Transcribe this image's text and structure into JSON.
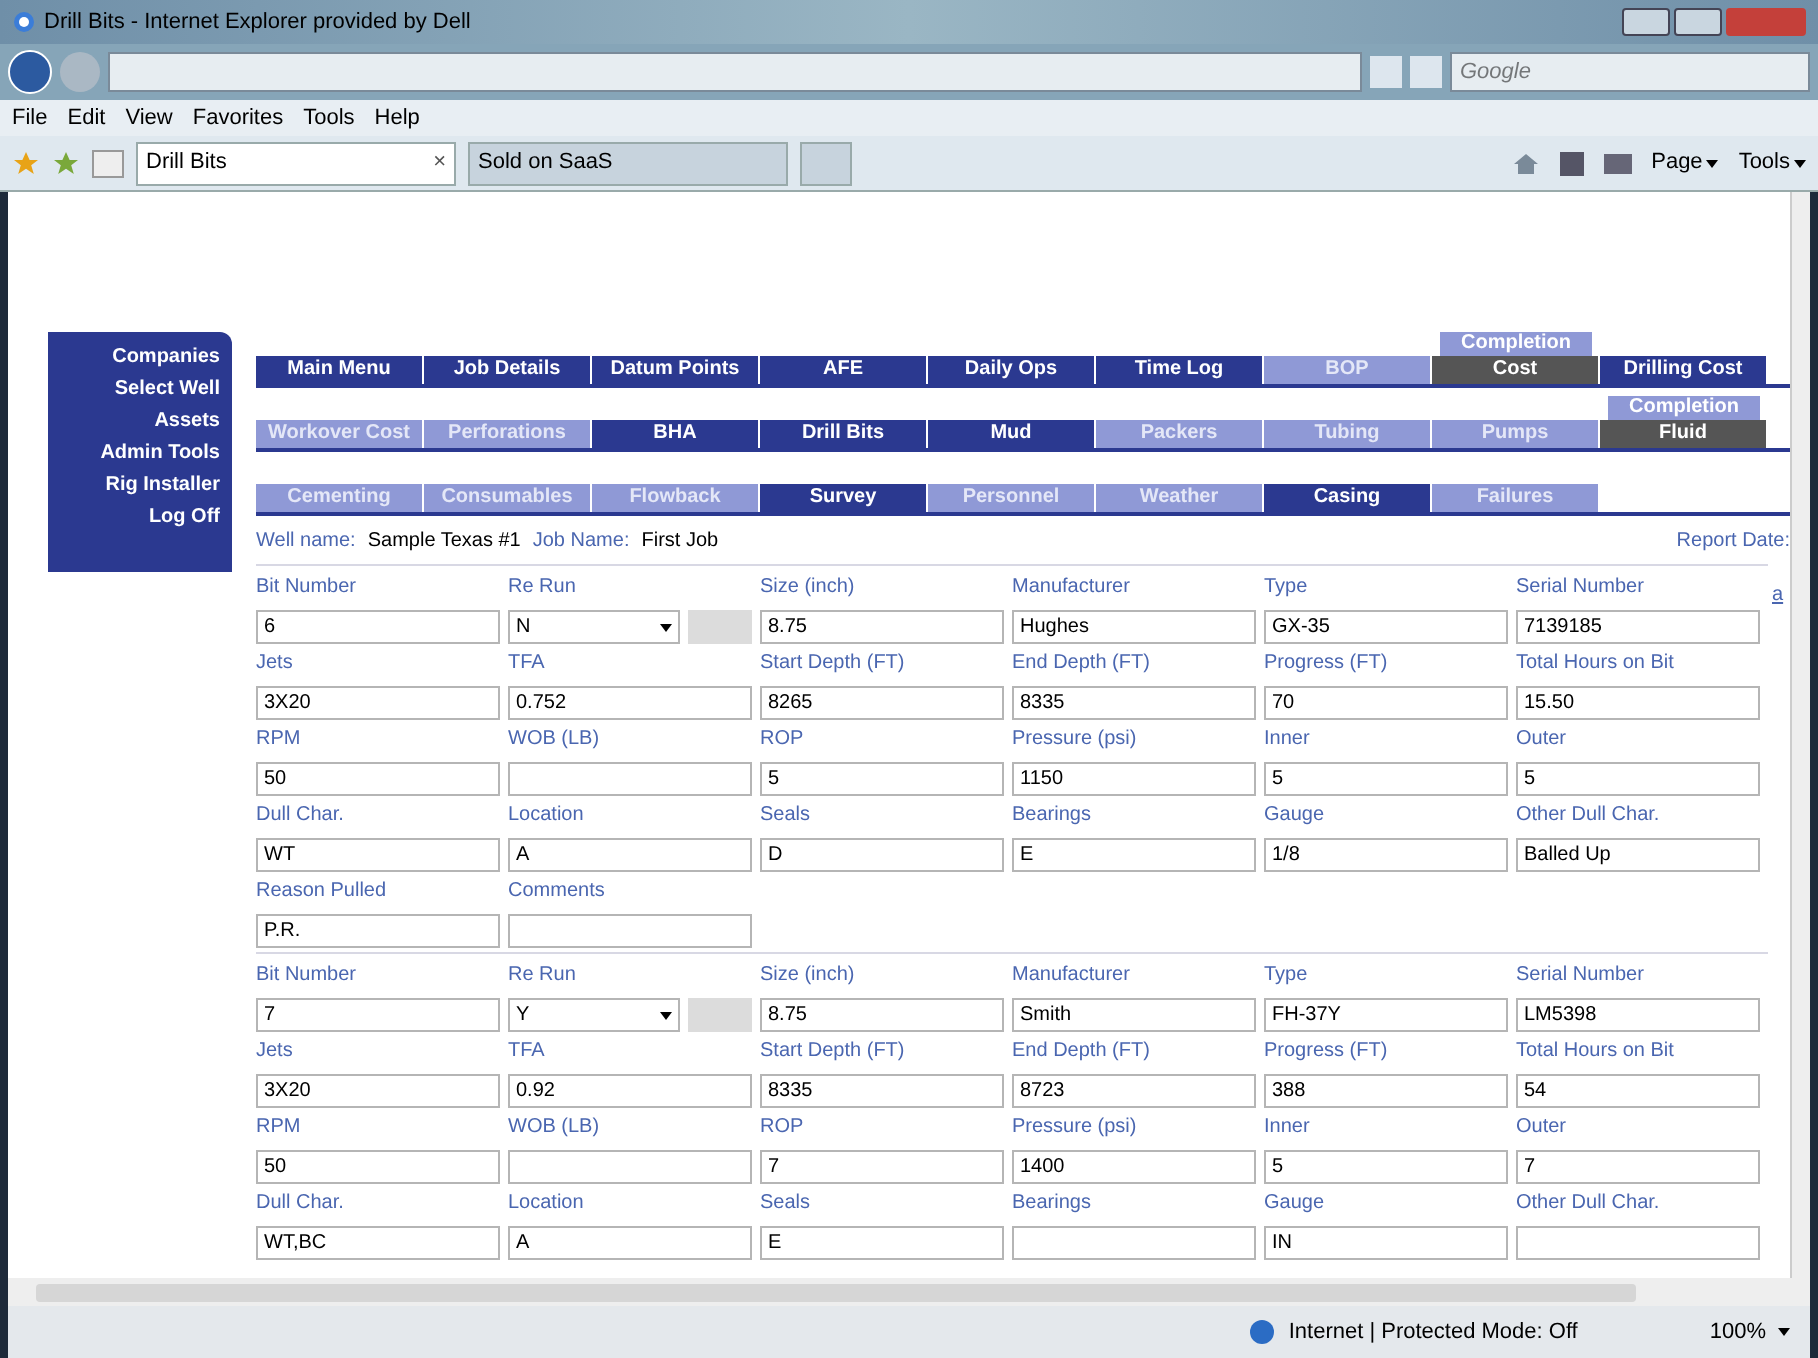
{
  "window": {
    "title": "Drill Bits - Internet Explorer provided by Dell"
  },
  "address_bar": {
    "search_placeholder": "Google"
  },
  "menu": [
    "File",
    "Edit",
    "View",
    "Favorites",
    "Tools",
    "Help"
  ],
  "browser_tabs": [
    {
      "label": "Drill Bits",
      "selected": true,
      "close": "×"
    },
    {
      "label": "Sold on SaaS",
      "selected": false
    }
  ],
  "command_bar": [
    "Page",
    "Tools"
  ],
  "sidebar": {
    "items": [
      "Companies",
      "Select Well",
      "Assets",
      "Admin Tools",
      "Rig Installer",
      "Log Off"
    ]
  },
  "nav_rows": [
    [
      {
        "label": "Main Menu",
        "kind": "dark"
      },
      {
        "label": "Job Details",
        "kind": "dark"
      },
      {
        "label": "Datum Points",
        "kind": "dark"
      },
      {
        "label": "AFE",
        "kind": "dark"
      },
      {
        "label": "Daily Ops",
        "kind": "dark"
      },
      {
        "label": "Time Log",
        "kind": "dark"
      },
      {
        "label": "BOP",
        "kind": "light"
      },
      {
        "label": "Cost",
        "kind": "gray",
        "above": "Completion"
      },
      {
        "label": "Drilling Cost",
        "kind": "dark"
      }
    ],
    [
      {
        "label": "Workover Cost",
        "kind": "light"
      },
      {
        "label": "Perforations",
        "kind": "light"
      },
      {
        "label": "BHA",
        "kind": "dark"
      },
      {
        "label": "Drill Bits",
        "kind": "dark"
      },
      {
        "label": "Mud",
        "kind": "dark"
      },
      {
        "label": "Packers",
        "kind": "light"
      },
      {
        "label": "Tubing",
        "kind": "light"
      },
      {
        "label": "Pumps",
        "kind": "light"
      },
      {
        "label": "Fluid",
        "kind": "gray",
        "above": "Completion"
      }
    ],
    [
      {
        "label": "Cementing",
        "kind": "light"
      },
      {
        "label": "Consumables",
        "kind": "light"
      },
      {
        "label": "Flowback",
        "kind": "light"
      },
      {
        "label": "Survey",
        "kind": "dark"
      },
      {
        "label": "Personnel",
        "kind": "light"
      },
      {
        "label": "Weather",
        "kind": "light"
      },
      {
        "label": "Casing",
        "kind": "dark"
      },
      {
        "label": "Failures",
        "kind": "light"
      }
    ]
  ],
  "job": {
    "well_label": "Well name:",
    "well": "Sample Texas #1",
    "job_label": "Job Name:",
    "job": "First Job",
    "report_label": "Report Date:"
  },
  "edge_link": "a",
  "bits": [
    {
      "fields": [
        {
          "label": "Bit Number",
          "value": "6",
          "kind": "text"
        },
        {
          "label": "Re Run",
          "value": "N",
          "kind": "select"
        },
        {
          "label": "Size (inch)",
          "value": "8.75",
          "kind": "text"
        },
        {
          "label": "Manufacturer",
          "value": "Hughes",
          "kind": "text"
        },
        {
          "label": "Type",
          "value": "GX-35",
          "kind": "text"
        },
        {
          "label": "Serial Number",
          "value": "7139185",
          "kind": "text"
        },
        {
          "label": "Jets",
          "value": "3X20",
          "kind": "text"
        },
        {
          "label": "TFA",
          "value": "0.752",
          "kind": "text"
        },
        {
          "label": "Start Depth (FT)",
          "value": "8265",
          "kind": "text"
        },
        {
          "label": "End Depth (FT)",
          "value": "8335",
          "kind": "text"
        },
        {
          "label": "Progress (FT)",
          "value": "70",
          "kind": "text"
        },
        {
          "label": "Total Hours on Bit",
          "value": "15.50",
          "kind": "text"
        },
        {
          "label": "RPM",
          "value": "50",
          "kind": "text"
        },
        {
          "label": "WOB (LB)",
          "kind": "text"
        },
        {
          "label": "ROP",
          "value": "5",
          "kind": "text"
        },
        {
          "label": "Pressure (psi)",
          "value": "1150",
          "kind": "text"
        },
        {
          "label": "Inner",
          "value": "5",
          "kind": "text"
        },
        {
          "label": "Outer",
          "value": "5",
          "kind": "text"
        },
        {
          "label": "Dull Char.",
          "value": "WT",
          "kind": "text"
        },
        {
          "label": "Location",
          "value": "A",
          "kind": "text"
        },
        {
          "label": "Seals",
          "value": "D",
          "kind": "text"
        },
        {
          "label": "Bearings",
          "value": "E",
          "kind": "text"
        },
        {
          "label": "Gauge",
          "value": "1/8",
          "kind": "text"
        },
        {
          "label": "Other Dull Char.",
          "value": "Balled Up",
          "kind": "text"
        },
        {
          "label": "Reason Pulled",
          "value": "P.R.",
          "kind": "text"
        },
        {
          "label": "Comments",
          "kind": "text"
        }
      ]
    },
    {
      "fields": [
        {
          "label": "Bit Number",
          "value": "7",
          "kind": "text"
        },
        {
          "label": "Re Run",
          "value": "Y",
          "kind": "select"
        },
        {
          "label": "Size (inch)",
          "value": "8.75",
          "kind": "text"
        },
        {
          "label": "Manufacturer",
          "value": "Smith",
          "kind": "text"
        },
        {
          "label": "Type",
          "value": "FH-37Y",
          "kind": "text"
        },
        {
          "label": "Serial Number",
          "value": "LM5398",
          "kind": "text"
        },
        {
          "label": "Jets",
          "value": "3X20",
          "kind": "text"
        },
        {
          "label": "TFA",
          "value": "0.92",
          "kind": "text"
        },
        {
          "label": "Start Depth (FT)",
          "value": "8335",
          "kind": "text"
        },
        {
          "label": "End Depth (FT)",
          "value": "8723",
          "kind": "text"
        },
        {
          "label": "Progress (FT)",
          "value": "388",
          "kind": "text"
        },
        {
          "label": "Total Hours on Bit",
          "value": "54",
          "kind": "text"
        },
        {
          "label": "RPM",
          "value": "50",
          "kind": "text"
        },
        {
          "label": "WOB (LB)",
          "kind": "text"
        },
        {
          "label": "ROP",
          "value": "7",
          "kind": "text"
        },
        {
          "label": "Pressure (psi)",
          "value": "1400",
          "kind": "text"
        },
        {
          "label": "Inner",
          "value": "5",
          "kind": "text"
        },
        {
          "label": "Outer",
          "value": "7",
          "kind": "text"
        },
        {
          "label": "Dull Char.",
          "value": "WT,BC",
          "kind": "text"
        },
        {
          "label": "Location",
          "value": "A",
          "kind": "text"
        },
        {
          "label": "Seals",
          "value": "E",
          "kind": "text"
        },
        {
          "label": "Bearings",
          "kind": "text"
        },
        {
          "label": "Gauge",
          "value": "IN",
          "kind": "text"
        },
        {
          "label": "Other Dull Char.",
          "kind": "text"
        }
      ]
    }
  ],
  "status_bar": {
    "zone": "Internet | Protected Mode: Off",
    "zoom": "100%"
  }
}
